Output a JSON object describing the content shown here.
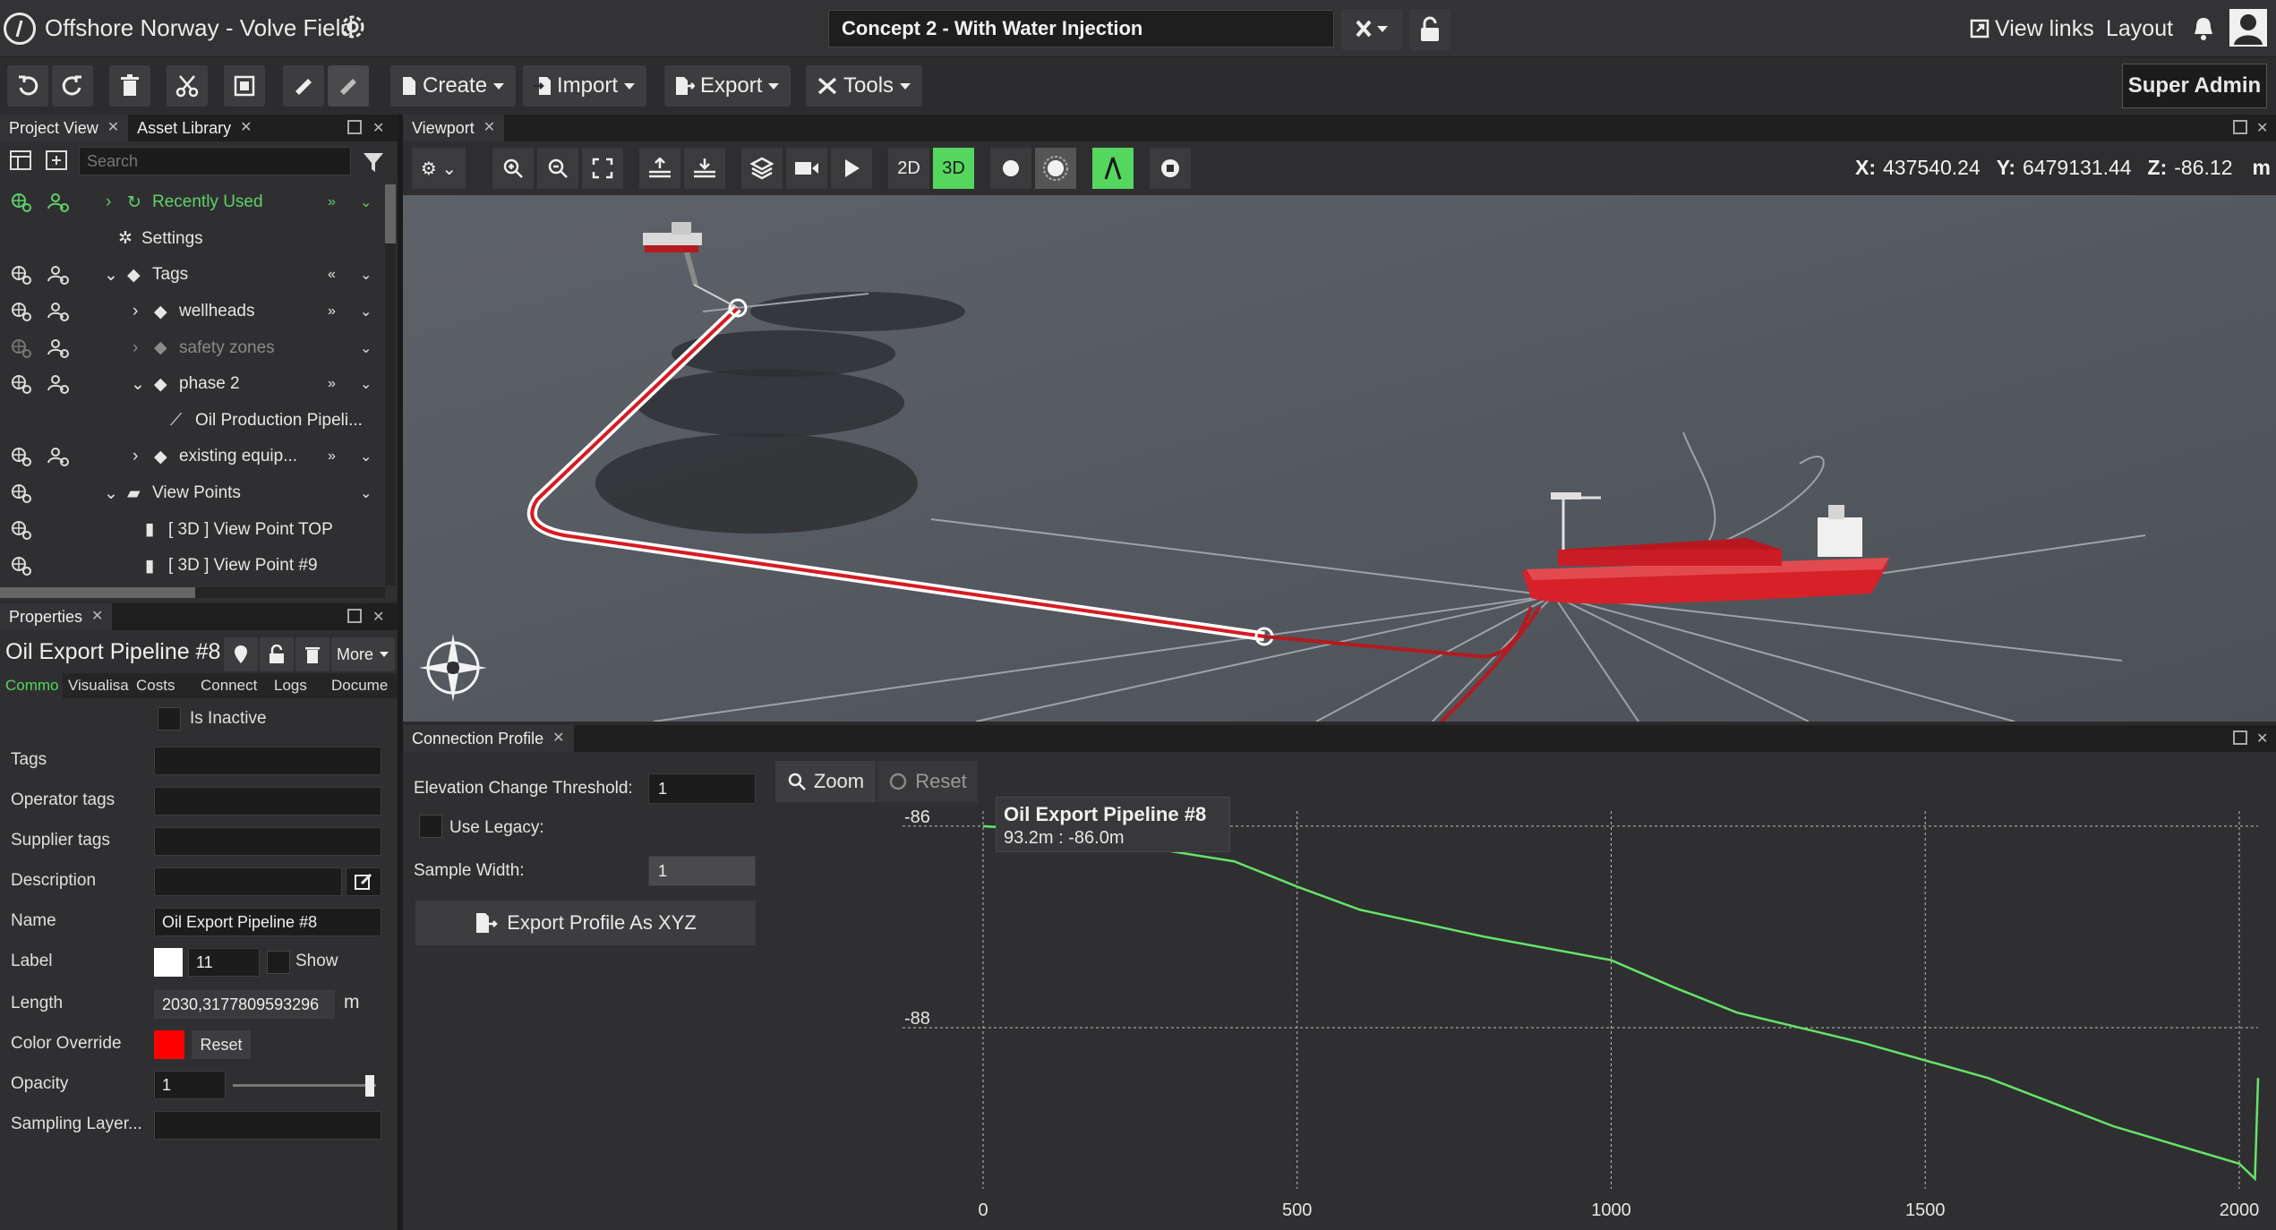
{
  "app": {
    "project_title": "Offshore Norway - Volve Field",
    "scenario": "Concept 2 - With Water Injection",
    "view_links": "View links",
    "layout": "Layout",
    "user": "Super Admin"
  },
  "toolbar": {
    "create": "Create",
    "import": "Import",
    "export": "Export",
    "tools": "Tools"
  },
  "left_tabs": {
    "project_view": "Project View",
    "asset_library": "Asset Library"
  },
  "tree": {
    "search_placeholder": "Search",
    "items": [
      {
        "label": "Recently Used"
      },
      {
        "label": "Settings"
      },
      {
        "label": "Tags"
      },
      {
        "label": "wellheads"
      },
      {
        "label": "safety zones"
      },
      {
        "label": "phase 2"
      },
      {
        "label": "Oil Production Pipeli..."
      },
      {
        "label": "existing equip..."
      },
      {
        "label": "View Points"
      },
      {
        "label": "[ 3D ] View Point TOP"
      },
      {
        "label": "[ 3D ] View Point #9"
      }
    ]
  },
  "properties": {
    "tab": "Properties",
    "object_name": "Oil Export Pipeline #8",
    "more": "More",
    "subtabs": [
      "Commo",
      "Visualisa",
      "Costs",
      "Connect",
      "Logs",
      "Docume"
    ],
    "is_inactive": "Is Inactive",
    "tags_label": "Tags",
    "operator_tags_label": "Operator tags",
    "supplier_tags_label": "Supplier tags",
    "description_label": "Description",
    "name_label": "Name",
    "name_value": "Oil Export Pipeline #8",
    "label_label": "Label",
    "label_value": "11",
    "show": "Show",
    "length_label": "Length",
    "length_value": "2030,3177809593296",
    "length_unit": "m",
    "color_override_label": "Color Override",
    "color_override_value": "#ff0000",
    "reset": "Reset",
    "opacity_label": "Opacity",
    "opacity_value": "1",
    "sampling_layer_label": "Sampling Layer..."
  },
  "viewport": {
    "tab": "Viewport",
    "btn_2d": "2D",
    "btn_3d": "3D",
    "x_label": "X:",
    "x_value": "437540.24",
    "y_label": "Y:",
    "y_value": "6479131.44",
    "z_label": "Z:",
    "z_value": "-86.12",
    "unit": "m"
  },
  "connection_profile": {
    "tab": "Connection Profile",
    "elevation_label": "Elevation Change Threshold:",
    "elevation_value": "1",
    "use_legacy": "Use Legacy:",
    "sample_width_label": "Sample Width:",
    "sample_width_value": "1",
    "export_btn": "Export Profile As XYZ",
    "zoom": "Zoom",
    "reset": "Reset",
    "tooltip_title": "Oil Export Pipeline #8",
    "tooltip_value": "93.2m : -86.0m"
  },
  "colors": {
    "accent_green": "#55d65e",
    "profile_line": "#66e36a",
    "color_override": "#ff0000"
  },
  "chart_data": {
    "type": "line",
    "x": [
      0,
      93.2,
      200,
      400,
      500,
      600,
      800,
      1000,
      1100,
      1200,
      1400,
      1600,
      1800,
      2000,
      2025,
      2030
    ],
    "y": [
      -86.0,
      -86.04,
      -86.15,
      -86.35,
      -86.6,
      -86.83,
      -87.1,
      -87.33,
      -87.6,
      -87.85,
      -88.15,
      -88.5,
      -88.98,
      -89.35,
      -89.5,
      -88.5
    ],
    "xlim": [
      0,
      2030
    ],
    "ylim": [
      -89.6,
      -85.85
    ],
    "xticks": [
      "0",
      "500",
      "1000",
      "1500",
      "2000"
    ],
    "yticks": [
      "-86",
      "-88"
    ],
    "grid": true
  }
}
